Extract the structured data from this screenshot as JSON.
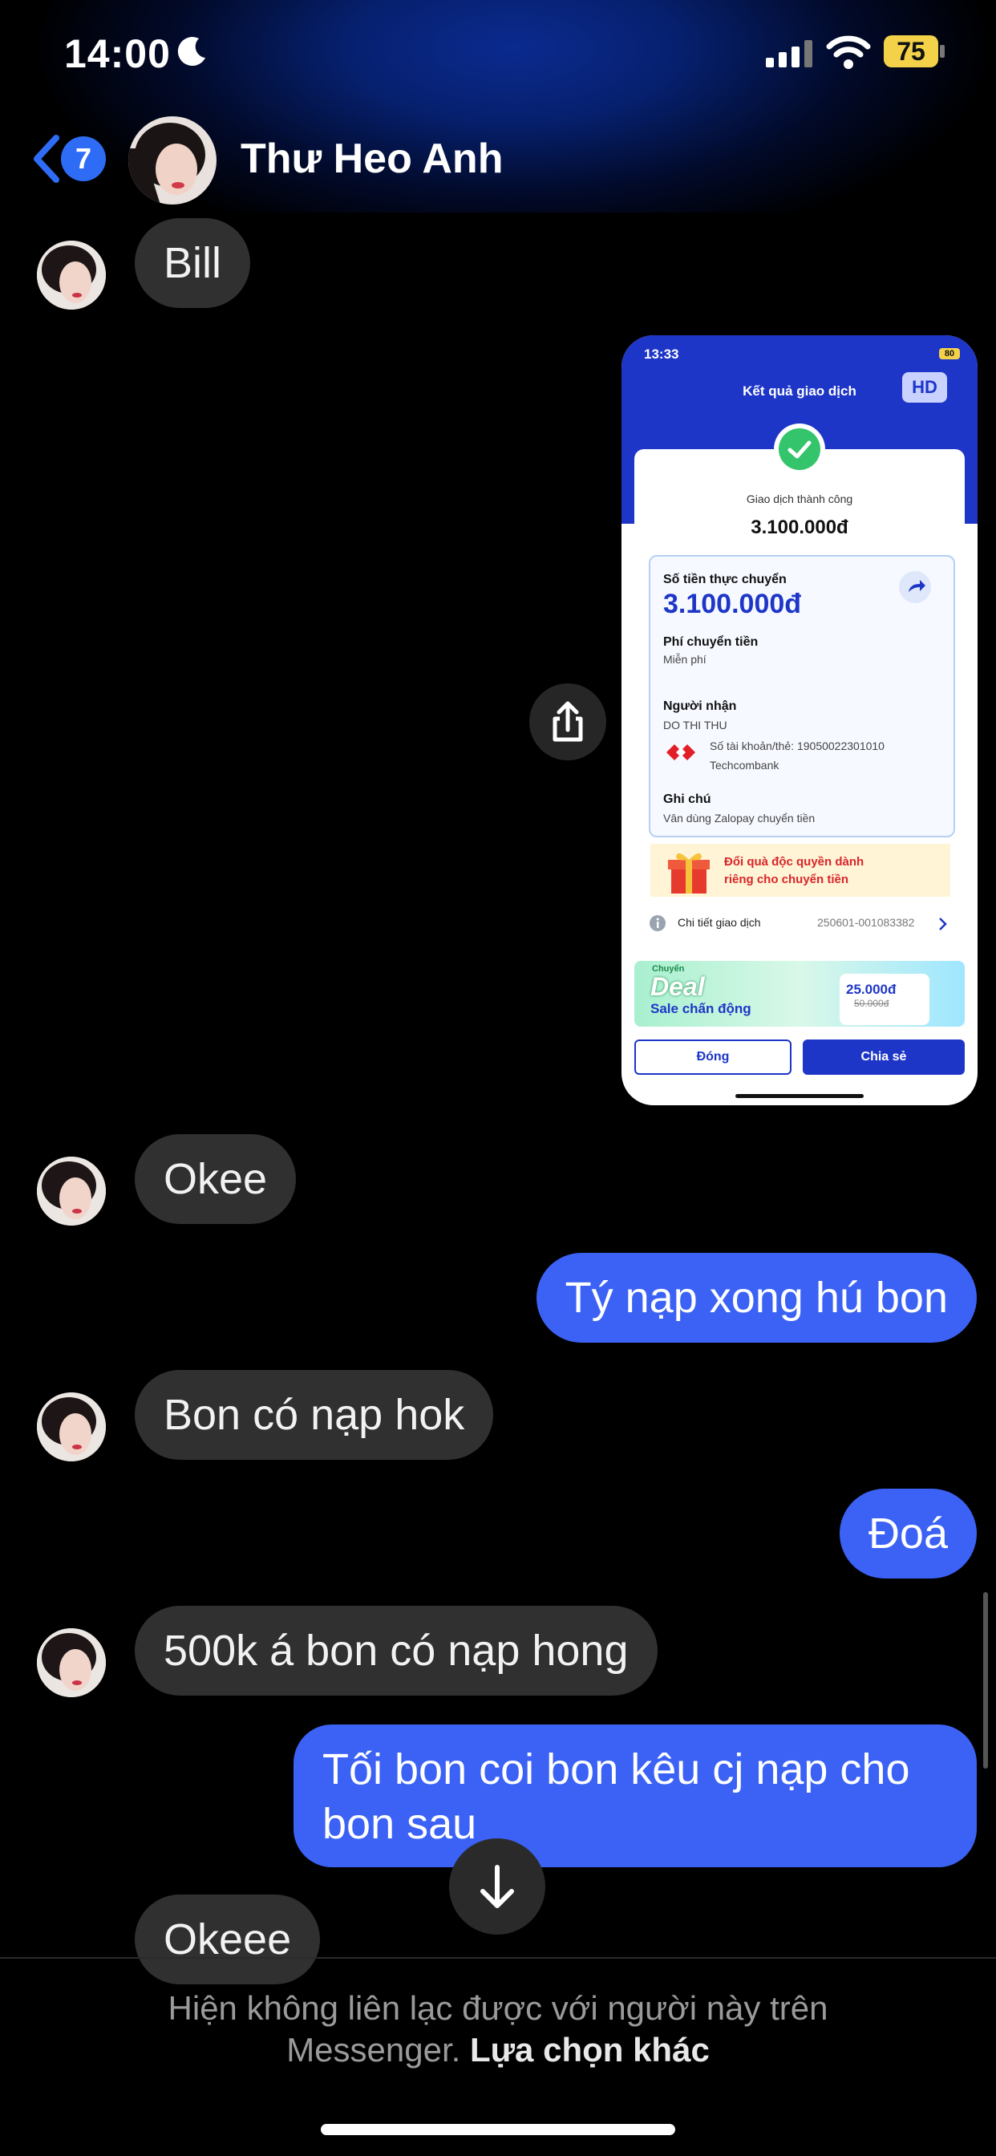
{
  "status": {
    "time": "14:00",
    "battery": "75"
  },
  "header": {
    "back_count": "7",
    "contact_name": "Thư Heo Anh"
  },
  "messages": [
    {
      "side": "in",
      "text": "Bill"
    },
    {
      "side": "in",
      "text": "Okee"
    },
    {
      "side": "out",
      "text": "Tý nạp xong hú bon"
    },
    {
      "side": "in",
      "text": "Bon có nạp hok"
    },
    {
      "side": "out",
      "text": "Đoá"
    },
    {
      "side": "in",
      "text": "500k á bon có nạp hong"
    },
    {
      "side": "out",
      "text": "Tối bon coi bon kêu cj nạp cho bon sau"
    },
    {
      "side": "in",
      "text": "Okeee"
    }
  ],
  "shared_image": {
    "status_time": "13:33",
    "status_battery": "80",
    "title": "Kết quả giao dịch",
    "hd": "HD",
    "result": "Giao dịch thành công",
    "amount": "3.100.000đ",
    "transfer_label": "Số tiền thực chuyển",
    "transfer_amount": "3.100.000đ",
    "fee_label": "Phí chuyển tiền",
    "fee_value": "Miễn phí",
    "recipient_label": "Người nhận",
    "recipient_name": "DO THI THU",
    "account_line": "Số tài khoản/thẻ: 19050022301010",
    "bank": "Techcombank",
    "note_label": "Ghi chú",
    "note_value": "Vân dùng Zalopay chuyển tiền",
    "promo_line1": "Đổi quà độc quyền dành",
    "promo_line2": "riêng cho chuyển tiền",
    "detail_label": "Chi tiết giao dịch",
    "detail_id": "250601-001083382",
    "banner_small": "Chuyển",
    "banner_deal": "Deal",
    "banner_sale": "Sale chấn động",
    "banner_price": "25.000đ",
    "banner_old_price": "50.000đ",
    "close_btn": "Đóng",
    "share_btn": "Chia sẻ"
  },
  "footer": {
    "notice_line1": "Hiện không liên lạc được với người này trên",
    "notice_line2_prefix": "Messenger. ",
    "notice_link": "Lựa chọn khác"
  },
  "colors": {
    "outgoing": "#3b62f5",
    "incoming": "#303030",
    "accent": "#2f6cf6"
  }
}
